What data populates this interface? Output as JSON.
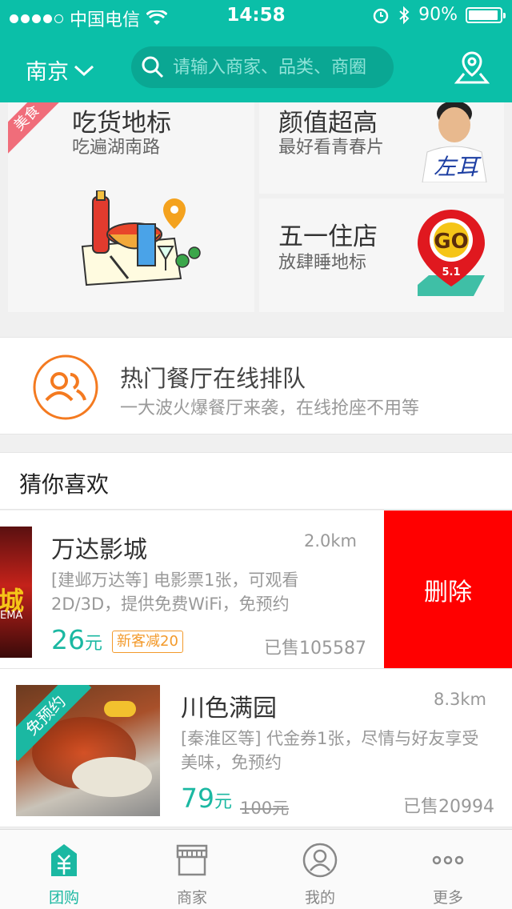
{
  "status_bar": {
    "carrier": "中国电信",
    "time": "14:58",
    "battery": "90%"
  },
  "header": {
    "city": "南京",
    "search_placeholder": "请输入商家、品类、商圈"
  },
  "promos": [
    {
      "ribbon": "美食",
      "title": "吃货地标",
      "subtitle": "吃遍湖南路"
    },
    {
      "title": "颜值超高",
      "subtitle": "最好看青春片",
      "art_text": "左耳"
    },
    {
      "title": "五一住店",
      "subtitle": "放肆睡地标",
      "badge": "GO",
      "badge_sub": "5.1"
    }
  ],
  "queue": {
    "title": "热门餐厅在线排队",
    "subtitle": "一大波火爆餐厅来袭，在线抢座不用等"
  },
  "recommend": {
    "title": "猜你喜欢",
    "items": [
      {
        "name": "万达影城",
        "distance": "2.0km",
        "desc": "[建邺万达等] 电影票1张，可观看2D/3D，提供免费WiFi，免预约",
        "price": "26",
        "unit": "元",
        "tag": "新客减20",
        "sold": "已售105587",
        "delete_label": "删除",
        "thumb_text": "城",
        "thumb_sub": "EMA"
      },
      {
        "name": "川色满园",
        "distance": "8.3km",
        "desc": "[秦淮区等] 代金券1张，尽情与好友享受美味，免预约",
        "price": "79",
        "unit": "元",
        "original": "100元",
        "sold": "已售20994",
        "thumb_ribbon": "免预约"
      }
    ]
  },
  "tabs": [
    {
      "label": "团购",
      "icon": "groupbuy-icon",
      "active": true
    },
    {
      "label": "商家",
      "icon": "store-icon",
      "active": false
    },
    {
      "label": "我的",
      "icon": "user-icon",
      "active": false
    },
    {
      "label": "更多",
      "icon": "more-icon",
      "active": false
    }
  ],
  "colors": {
    "brand": "#0bbfa8",
    "price": "#1bb8a2",
    "delete": "#ff0000",
    "tag": "#f39a2b"
  }
}
